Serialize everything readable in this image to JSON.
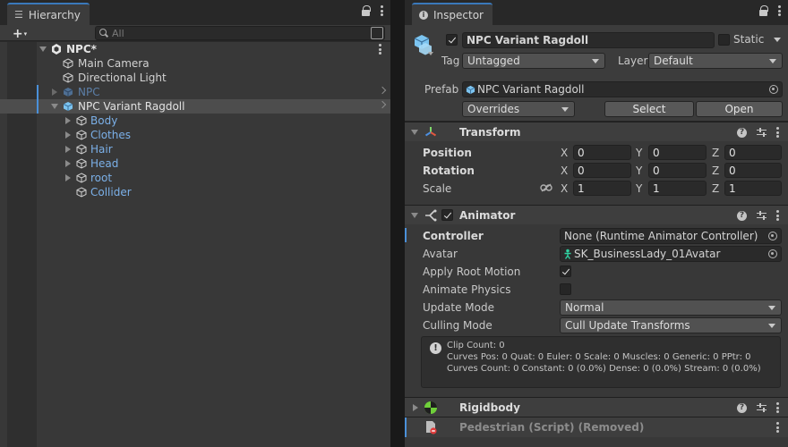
{
  "hierarchy": {
    "tab_label": "Hierarchy",
    "search_placeholder": "All",
    "add_label": "+",
    "rows": [
      {
        "label": "NPC*"
      },
      {
        "label": "Main Camera"
      },
      {
        "label": "Directional Light"
      },
      {
        "label": "NPC"
      },
      {
        "label": "NPC Variant Ragdoll"
      },
      {
        "label": "Body"
      },
      {
        "label": "Clothes"
      },
      {
        "label": "Hair"
      },
      {
        "label": "Head"
      },
      {
        "label": "root"
      },
      {
        "label": "Collider"
      }
    ]
  },
  "inspector": {
    "tab_label": "Inspector",
    "object_name": "NPC Variant Ragdoll",
    "static_label": "Static",
    "tag_label": "Tag",
    "tag_value": "Untagged",
    "layer_label": "Layer",
    "layer_value": "Default",
    "prefab_label": "Prefab",
    "prefab_value": "NPC Variant Ragdoll",
    "overrides_label": "Overrides",
    "select_label": "Select",
    "open_label": "Open",
    "transform": {
      "title": "Transform",
      "position_label": "Position",
      "rotation_label": "Rotation",
      "scale_label": "Scale",
      "x": "X",
      "y": "Y",
      "z": "Z",
      "position": [
        "0",
        "0",
        "0"
      ],
      "rotation": [
        "0",
        "0",
        "0"
      ],
      "scale": [
        "1",
        "1",
        "1"
      ]
    },
    "animator": {
      "title": "Animator",
      "controller_label": "Controller",
      "controller_value": "None (Runtime Animator Controller)",
      "avatar_label": "Avatar",
      "avatar_value": "SK_BusinessLady_01Avatar",
      "apply_root_motion_label": "Apply Root Motion",
      "animate_physics_label": "Animate Physics",
      "update_mode_label": "Update Mode",
      "update_mode_value": "Normal",
      "culling_mode_label": "Culling Mode",
      "culling_mode_value": "Cull Update Transforms",
      "info_line1": "Clip Count: 0",
      "info_line2": "Curves Pos: 0 Quat: 0 Euler: 0 Scale: 0 Muscles: 0 Generic: 0 PPtr: 0",
      "info_line3": "Curves Count: 0 Constant: 0 (0.0%) Dense: 0 (0.0%) Stream: 0 (0.0%)"
    },
    "rigidbody": {
      "title": "Rigidbody"
    },
    "script": {
      "title": "Pedestrian (Script) (Removed)"
    }
  },
  "colors": {
    "accent_blue": "#4a90d9",
    "prefab_blue": "#7bb0e8",
    "panel_bg": "#383838"
  }
}
